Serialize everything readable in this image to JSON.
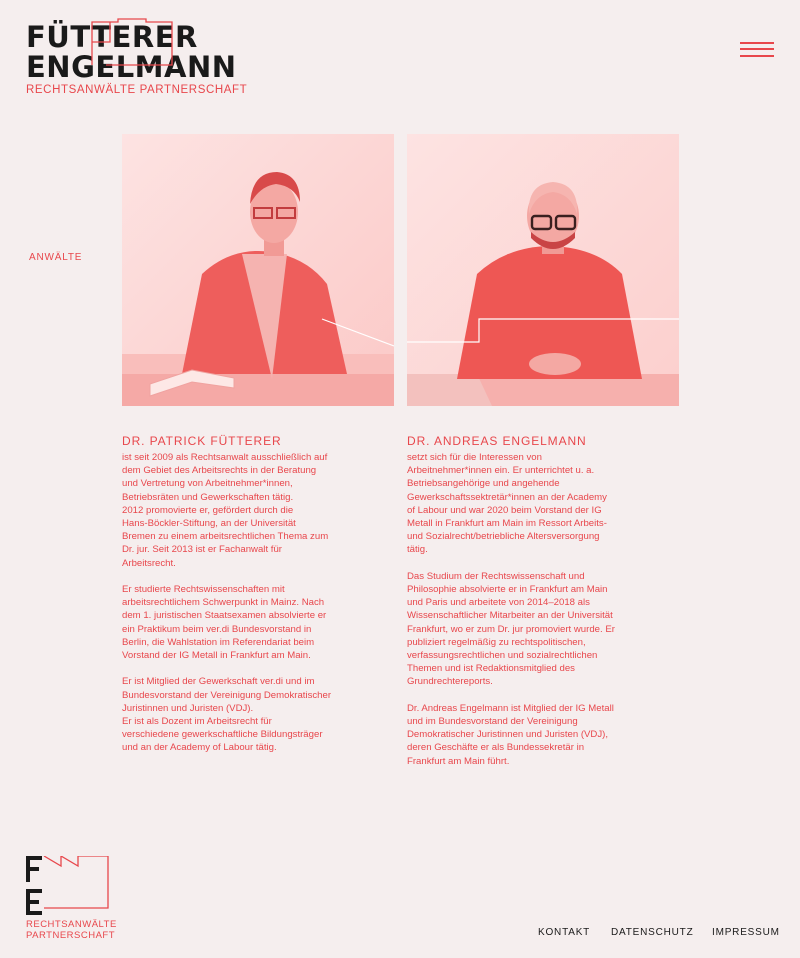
{
  "brand": {
    "line1": "FÜTTERER",
    "line2": "ENGELMANN",
    "subtitle": "RECHTSANWÄLTE PARTNERSCHAFT",
    "footer_subtitle": "RECHTSANWÄLTE\nPARTNERSCHAFT",
    "monogram": "FE",
    "text_color": "#1a1a1a",
    "accent_color": "#e8474c"
  },
  "menu": {
    "icon": "hamburger-menu-icon"
  },
  "section": {
    "label": "ANWÄLTE"
  },
  "lawyers": [
    {
      "name": "DR. PATRICK FÜTTERER",
      "paragraphs": [
        "ist seit 2009 als Rechtsanwalt ausschließlich auf\ndem Gebiet des Arbeitsrechts in der Beratung\nund Vertretung von Arbeitnehmer*innen,\nBetriebsräten und Gewerkschaften tätig.\n2012 promovierte er, gefördert durch die\nHans-Böckler-Stiftung, an der Universität\nBremen zu einem arbeitsrechtlichen Thema zum\nDr. jur. Seit 2013 ist er Fachanwalt für\nArbeitsrecht.",
        "Er studierte Rechtswissenschaften mit\narbeitsrechtlichem Schwerpunkt in Mainz. Nach\ndem 1. juristischen Staatsexamen absolvierte er\nein Praktikum beim ver.di Bundesvorstand in\nBerlin, die Wahlstation im Referendariat beim\nVorstand der IG Metall in Frankfurt am Main.",
        "Er ist Mitglied der Gewerkschaft ver.di und im\nBundesvorstand der Vereinigung Demokratischer\nJuristinnen und Juristen (VDJ).\nEr ist als Dozent im Arbeitsrecht für\nverschiedene gewerkschaftliche Bildungsträger\nund an der Academy of Labour tätig."
      ]
    },
    {
      "name": "DR. ANDREAS ENGELMANN",
      "paragraphs": [
        "setzt sich für die Interessen von\nArbeitnehmer*innen ein. Er unterrichtet u. a.\nBetriebsangehörige und angehende\nGewerkschaftssektretär*innen an der Academy\nof Labour und war 2020 beim Vorstand der IG\nMetall in Frankfurt am Main im Ressort Arbeits-\nund Sozialrecht/betriebliche Altersversorgung\ntätig.",
        "Das Studium der Rechtswissenschaft und\nPhilosophie absolvierte er in Frankfurt am Main\nund Paris und arbeitete von 2014–2018 als\nWissenschaftlicher Mitarbeiter an der Universität\nFrankfurt, wo er zum Dr. jur promoviert wurde. Er\npubliziert regelmäßig zu rechtspolitischen,\nverfassungsrechtlichen und sozialrechtlichen\nThemen und ist Redaktionsmitglied des\nGrundrechtereports.",
        "Dr. Andreas Engelmann ist Mitglied der IG Metall\nund im Bundesvorstand der Vereinigung\nDemokratischer Juristinnen und Juristen (VDJ),\nderen Geschäfte er als Bundessekretär in\nFrankfurt am Main führt."
      ]
    }
  ],
  "footer": {
    "nav": [
      "KONTAKT",
      "DATENSCHUTZ",
      "IMPRESSUM"
    ]
  }
}
